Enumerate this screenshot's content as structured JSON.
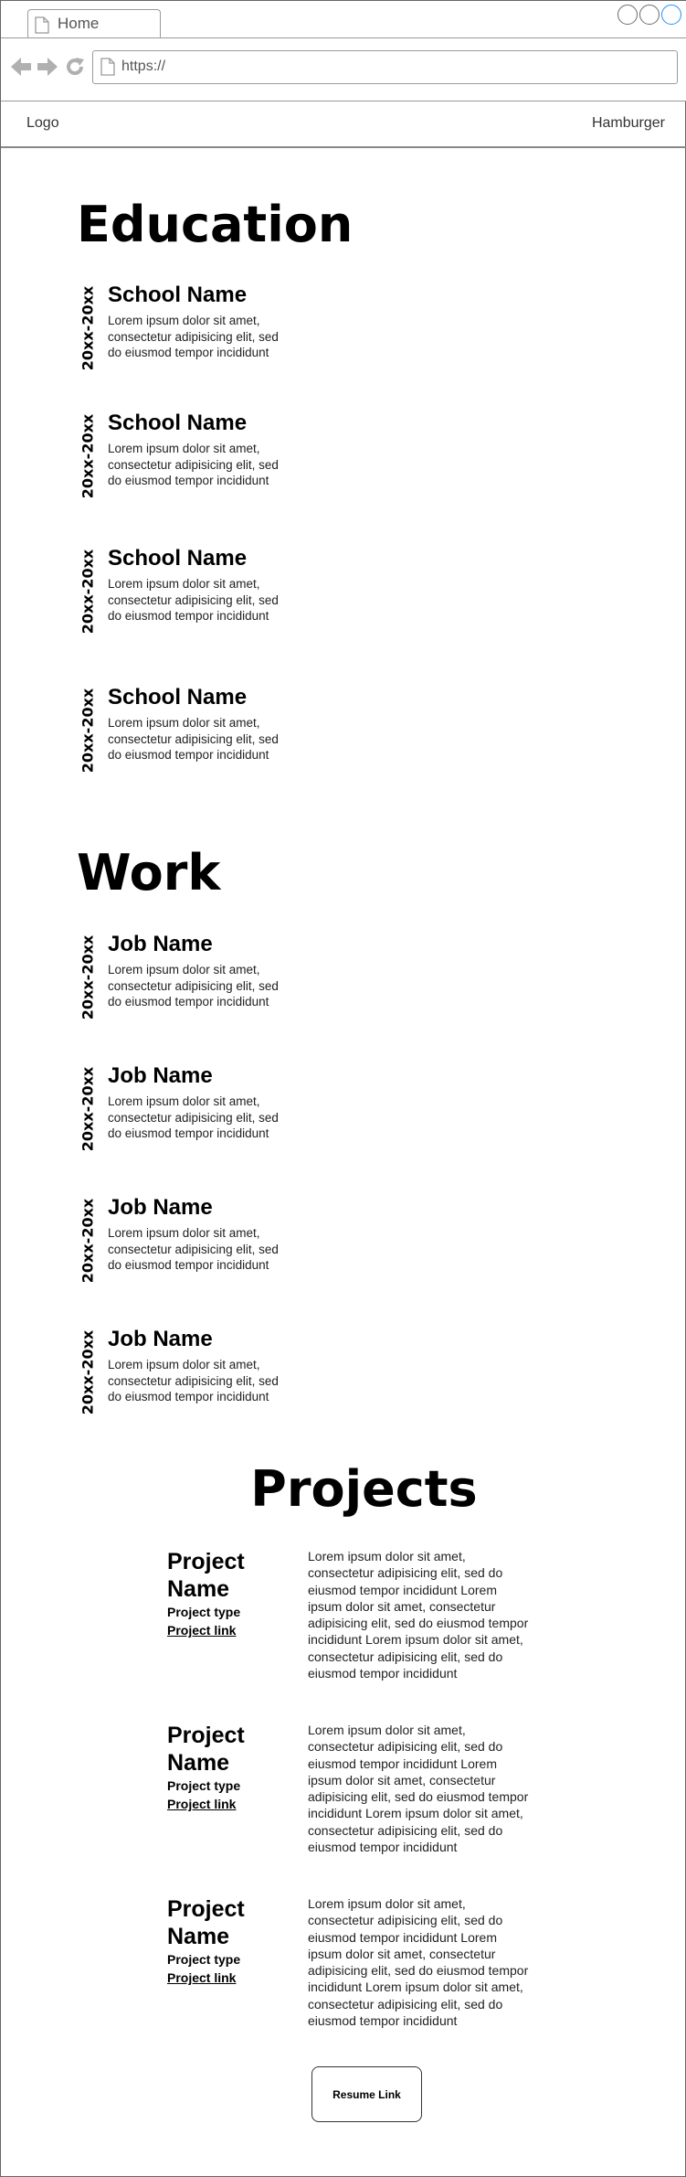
{
  "browser": {
    "tab_label": "Home",
    "url": "https://"
  },
  "header": {
    "logo": "Logo",
    "menu": "Hamburger"
  },
  "education": {
    "title": "Education",
    "items": [
      {
        "date": "20xx-20xx",
        "name": "School Name",
        "desc": "Lorem ipsum dolor sit amet, consectetur adipisicing elit, sed do eiusmod tempor incididunt"
      },
      {
        "date": "20xx-20xx",
        "name": "School Name",
        "desc": "Lorem ipsum dolor sit amet, consectetur adipisicing elit, sed do eiusmod tempor incididunt"
      },
      {
        "date": "20xx-20xx",
        "name": "School Name",
        "desc": "Lorem ipsum dolor sit amet, consectetur adipisicing elit, sed do eiusmod tempor incididunt"
      },
      {
        "date": "20xx-20xx",
        "name": "School Name",
        "desc": "Lorem ipsum dolor sit amet, consectetur adipisicing elit, sed do eiusmod tempor incididunt"
      }
    ]
  },
  "work": {
    "title": "Work",
    "items": [
      {
        "date": "20xx-20xx",
        "name": "Job Name",
        "desc": "Lorem ipsum dolor sit amet, consectetur adipisicing elit, sed do eiusmod tempor incididunt"
      },
      {
        "date": "20xx-20xx",
        "name": "Job Name",
        "desc": "Lorem ipsum dolor sit amet, consectetur adipisicing elit, sed do eiusmod tempor incididunt"
      },
      {
        "date": "20xx-20xx",
        "name": "Job Name",
        "desc": "Lorem ipsum dolor sit amet, consectetur adipisicing elit, sed do eiusmod tempor incididunt"
      },
      {
        "date": "20xx-20xx",
        "name": "Job Name",
        "desc": "Lorem ipsum dolor sit amet, consectetur adipisicing elit, sed do eiusmod tempor incididunt"
      }
    ]
  },
  "projects": {
    "title": "Projects",
    "items": [
      {
        "name": "Project Name",
        "type": "Project type",
        "link": "Project link",
        "desc": "Lorem ipsum dolor sit amet, consectetur adipisicing elit, sed do eiusmod tempor incididunt Lorem ipsum dolor sit amet, consectetur adipisicing elit, sed do eiusmod tempor incididunt Lorem ipsum dolor sit amet, consectetur adipisicing elit, sed do eiusmod tempor incididunt"
      },
      {
        "name": "Project Name",
        "type": "Project type",
        "link": "Project link",
        "desc": "Lorem ipsum dolor sit amet, consectetur adipisicing elit, sed do eiusmod tempor incididunt Lorem ipsum dolor sit amet, consectetur adipisicing elit, sed do eiusmod tempor incididunt Lorem ipsum dolor sit amet, consectetur adipisicing elit, sed do eiusmod tempor incididunt"
      },
      {
        "name": "Project Name",
        "type": "Project type",
        "link": "Project link",
        "desc": "Lorem ipsum dolor sit amet, consectetur adipisicing elit, sed do eiusmod tempor incididunt Lorem ipsum dolor sit amet, consectetur adipisicing elit, sed do eiusmod tempor incididunt Lorem ipsum dolor sit amet, consectetur adipisicing elit, sed do eiusmod tempor incididunt"
      }
    ]
  },
  "resume_button": "Resume Link"
}
